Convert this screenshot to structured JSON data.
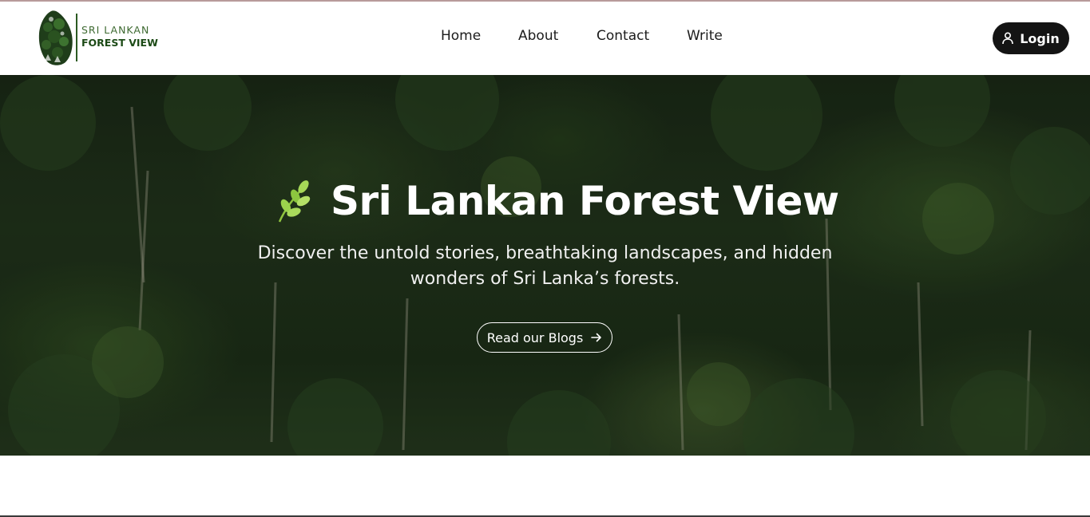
{
  "brand": {
    "line1": "SRI LANKAN",
    "line2": "FOREST VIEW",
    "logo_icon": "sri-lanka-forest-map-logo"
  },
  "nav": {
    "items": [
      {
        "label": "Home"
      },
      {
        "label": "About"
      },
      {
        "label": "Contact"
      },
      {
        "label": "Write"
      }
    ]
  },
  "login": {
    "label": "Login",
    "icon": "user-icon"
  },
  "hero": {
    "title": "Sri Lankan Forest View",
    "title_icon": "leaf-sprig-icon",
    "subtitle": "Discover the untold stories, breathtaking landscapes, and hidden wonders of Sri Lanka’s forests.",
    "cta_label": "Read our Blogs",
    "cta_icon": "arrow-right-icon"
  },
  "colors": {
    "brand_green": "#1c4a16",
    "button_dark": "#141414",
    "leaf_green": "#9cd24a"
  }
}
